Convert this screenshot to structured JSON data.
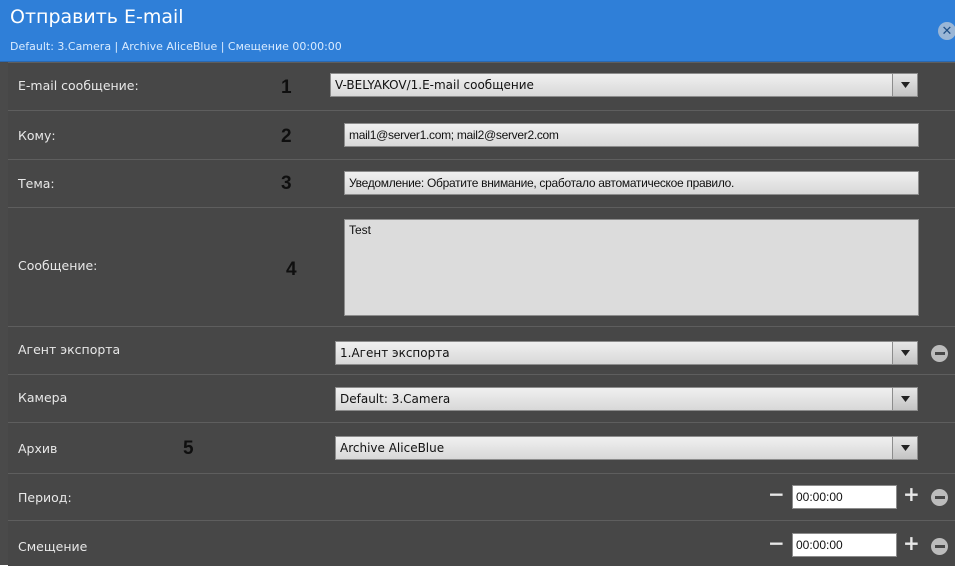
{
  "dialog": {
    "title": "Отправить E-mail",
    "subtitle": "Default: 3.Camera | Archive AliceBlue | Смещение 00:00:00",
    "close_icon": "close-icon"
  },
  "rows": {
    "email_message": {
      "label": "E-mail сообщение:",
      "number": "1",
      "value": "V-BELYAKOV/1.E-mail сообщение"
    },
    "to": {
      "label": "Кому:",
      "number": "2",
      "value": "mail1@server1.com; mail2@server2.com"
    },
    "subject": {
      "label": "Тема:",
      "number": "3",
      "value": "Уведомление: Обратите внимание, сработало автоматическое правило."
    },
    "message": {
      "label": "Сообщение:",
      "number": "4",
      "value": "Test"
    },
    "export_agent": {
      "label": "Агент экспорта",
      "value": "1.Агент экспорта"
    },
    "camera": {
      "label": "Камера",
      "value": "Default: 3.Camera"
    },
    "archive": {
      "label": "Архив",
      "number": "5",
      "value": "Archive AliceBlue"
    },
    "period": {
      "label": "Период:",
      "value": "00:00:00",
      "minus_label": "−",
      "plus_label": "+"
    },
    "offset": {
      "label": "Смещение",
      "value": "00:00:00",
      "minus_label": "−",
      "plus_label": "+"
    }
  },
  "colors": {
    "header": "#2f7fd8",
    "body": "#474747",
    "text": "#e8e8e8"
  }
}
